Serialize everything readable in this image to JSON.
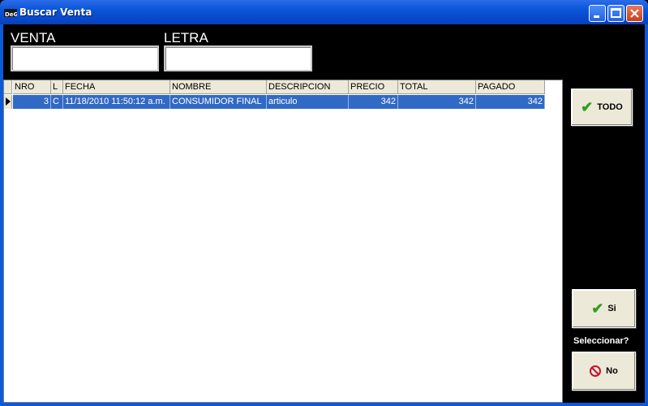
{
  "window": {
    "title": "Buscar Venta",
    "app_icon": "app-icon"
  },
  "filters": {
    "venta_label": "VENTA",
    "venta_value": "",
    "letra_label": "LETRA",
    "letra_value": ""
  },
  "grid": {
    "columns": [
      "NRO",
      "L",
      "FECHA",
      "NOMBRE",
      "DESCRIPCION",
      "PRECIO",
      "TOTAL",
      "PAGADO"
    ],
    "rows": [
      {
        "nro": "3",
        "l": "C",
        "fecha": "11/18/2010 11:50:12 a.m.",
        "nombre": "CONSUMIDOR FINAL",
        "descripcion": "articulo",
        "precio": "342",
        "total": "342",
        "pagado": "342"
      }
    ]
  },
  "side": {
    "todo_label": "TODO",
    "si_label": "Si",
    "seleccionar_label": "Seleccionar?",
    "no_label": "No"
  },
  "colors": {
    "selection": "#316ac5",
    "titlebar": "#0a55d9",
    "background": "#000000"
  }
}
